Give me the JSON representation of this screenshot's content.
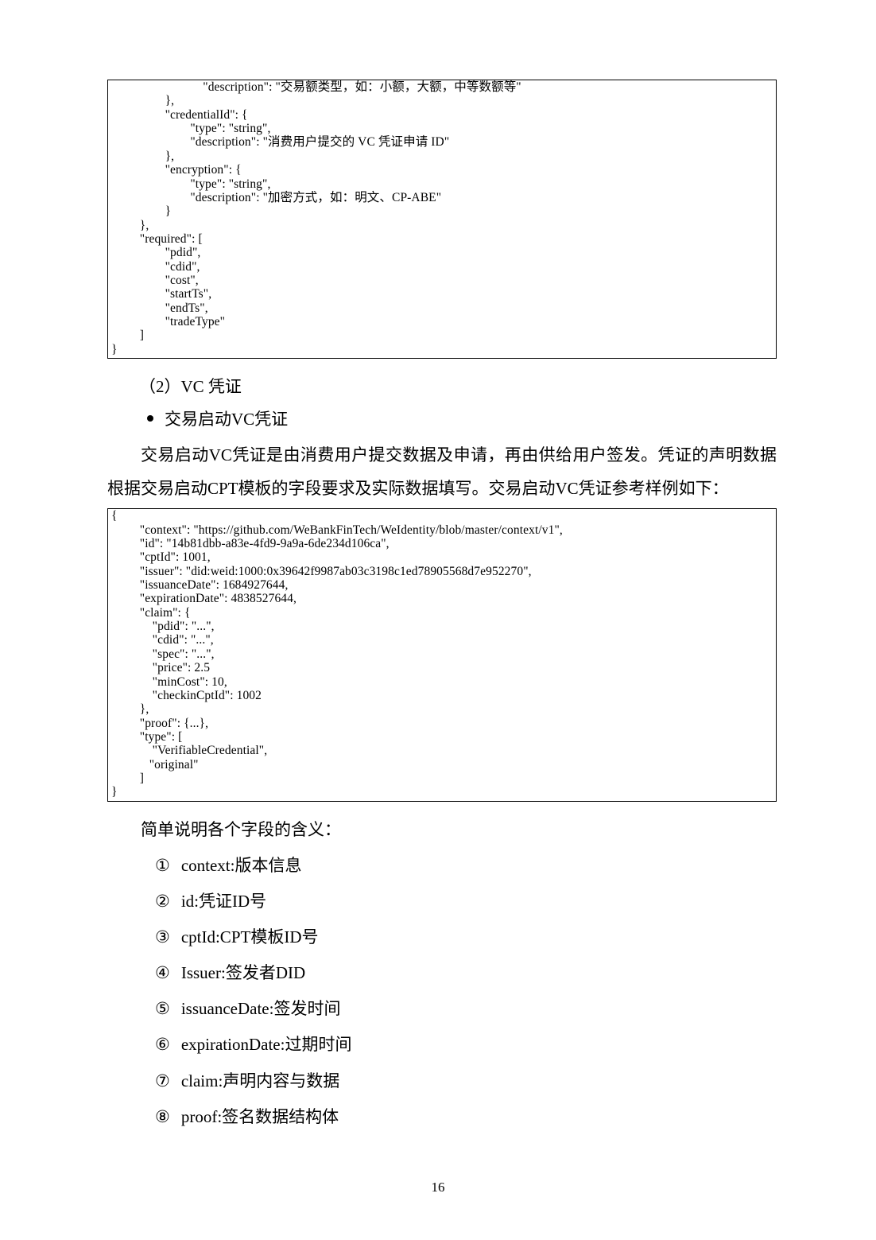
{
  "code1": "                             \"description\": \"交易额类型，如：小额，大额，中等数额等\"\n                 },\n                 \"credentialId\": {\n                         \"type\": \"string\",\n                         \"description\": \"消费用户提交的 VC 凭证申请 ID\"\n                 },\n                 \"encryption\": {\n                         \"type\": \"string\",\n                         \"description\": \"加密方式，如：明文、CP-ABE\"\n                 }\n         },\n         \"required\": [\n                 \"pdid\",\n                 \"cdid\",\n                 \"cost\",\n                 \"startTs\",\n                 \"endTs\",\n                 \"tradeType\"\n         ]\n}",
  "section_num": "（2）VC 凭证",
  "bullet1": "交易启动VC凭证",
  "para1": "交易启动VC凭证是由消费用户提交数据及申请，再由供给用户签发。凭证的声明数据根据交易启动CPT模板的字段要求及实际数据填写。交易启动VC凭证参考样例如下：",
  "code2": "{\n         \"context\": \"https://github.com/WeBankFinTech/WeIdentity/blob/master/context/v1\",\n         \"id\": \"14b81dbb-a83e-4fd9-9a9a-6de234d106ca\",\n         \"cptId\": 1001,\n         \"issuer\": \"did:weid:1000:0x39642f9987ab03c3198c1ed78905568d7e952270\",\n         \"issuanceDate\": 1684927644,\n         \"expirationDate\": 4838527644,\n         \"claim\": {\n             \"pdid\": \"...\",\n             \"cdid\": \"...\",\n             \"spec\": \"...\",\n             \"price\": 2.5\n             \"minCost\": 10,\n             \"checkinCptId\": 1002\n         },\n         \"proof\": {...},\n         \"type\": [\n             \"VerifiableCredential\",\n            \"original\"\n         ]\n}",
  "explain_title": "简单说明各个字段的含义：",
  "items": [
    {
      "n": "①",
      "t": "context:版本信息"
    },
    {
      "n": "②",
      "t": "id:凭证ID号"
    },
    {
      "n": "③",
      "t": "cptId:CPT模板ID号"
    },
    {
      "n": "④",
      "t": "Issuer:签发者DID"
    },
    {
      "n": "⑤",
      "t": "issuanceDate:签发时间"
    },
    {
      "n": "⑥",
      "t": "expirationDate:过期时间"
    },
    {
      "n": "⑦",
      "t": "claim:声明内容与数据"
    },
    {
      "n": "⑧",
      "t": "proof:签名数据结构体"
    }
  ],
  "page": "16"
}
